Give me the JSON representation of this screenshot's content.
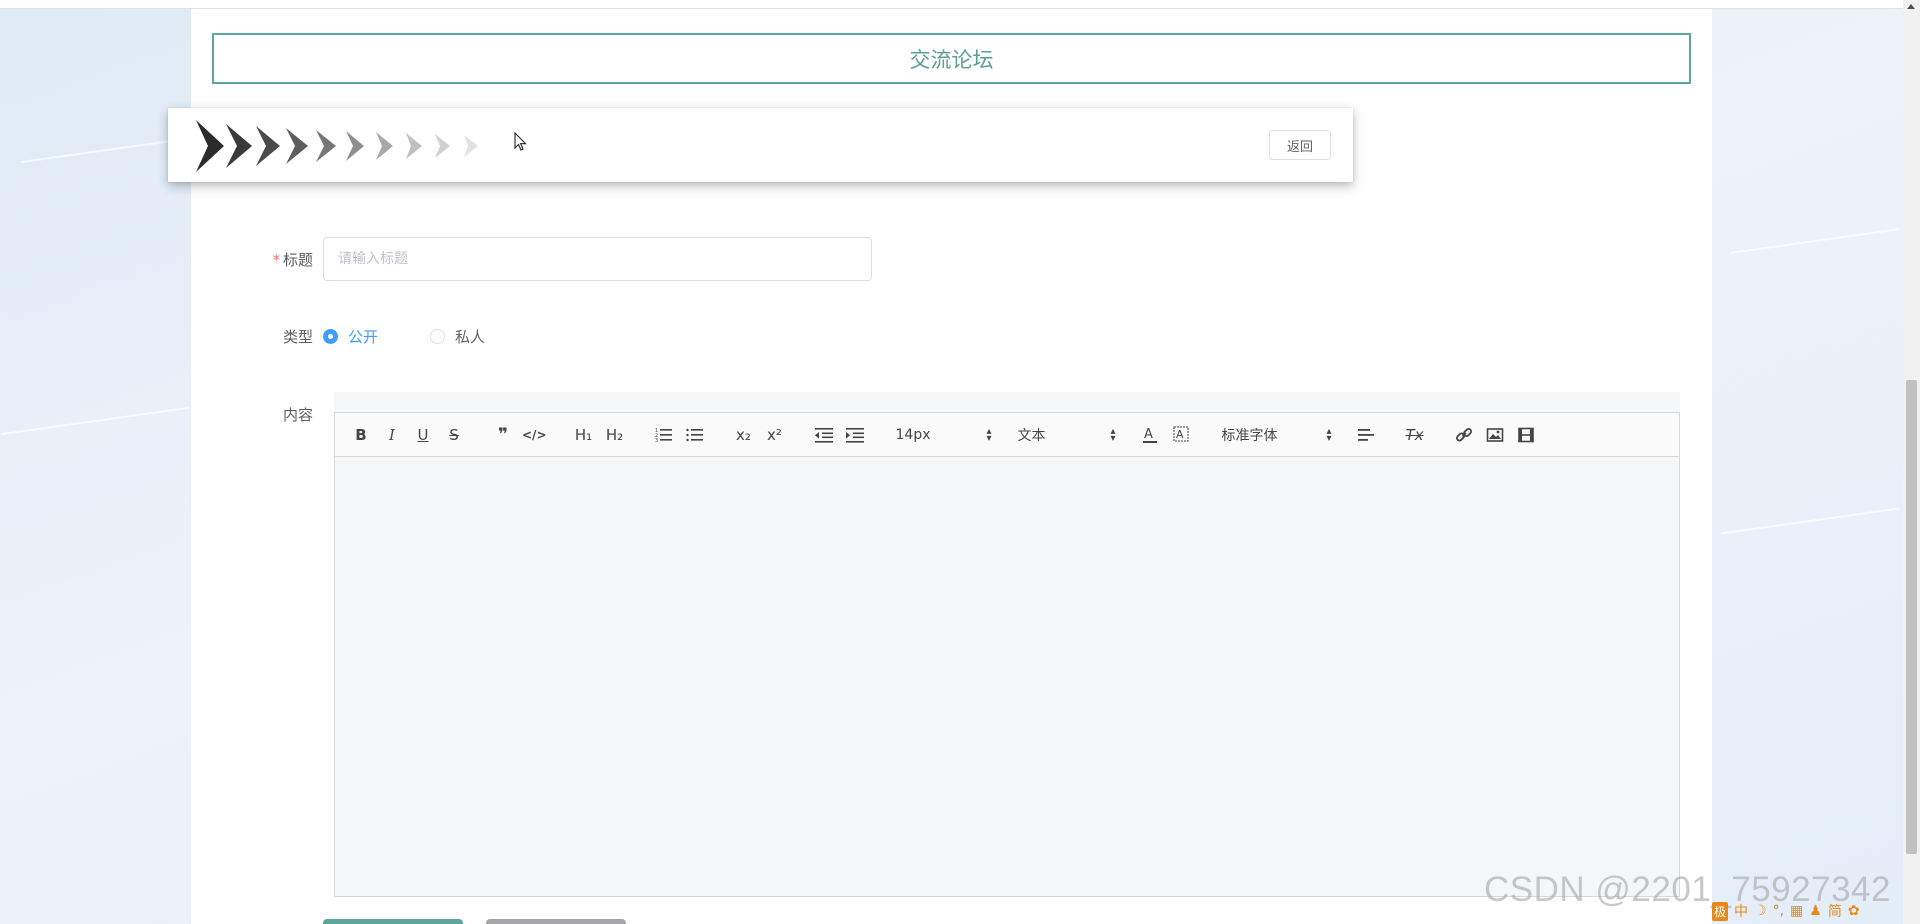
{
  "header": {
    "title": "交流论坛"
  },
  "banner": {
    "back_label": "返回"
  },
  "form": {
    "title_field": {
      "label": "标题",
      "required_mark": "*",
      "placeholder": "请输入标题",
      "value": ""
    },
    "type_field": {
      "label": "类型",
      "options": [
        {
          "label": "公开",
          "checked": true
        },
        {
          "label": "私人",
          "checked": false
        }
      ]
    },
    "content_field": {
      "label": "内容"
    }
  },
  "toolbar": {
    "bold": "B",
    "italic": "I",
    "underline": "U",
    "strike": "S",
    "blockquote": "❞",
    "code": "</>",
    "h1": "H₁",
    "h2": "H₂",
    "subscript": "x₂",
    "superscript": "x²",
    "font_size": "14px",
    "header_select": "文本",
    "font_family": "标准字体",
    "clean": "Tx"
  },
  "watermark": "CSDN @2201_75927342",
  "ime": {
    "items": [
      "极",
      "中",
      "☽",
      "°,",
      "▦",
      "♟",
      "简",
      "✿"
    ]
  },
  "colors": {
    "accent": "#5ea69c",
    "primary": "#409eff",
    "required": "#f56c6c"
  }
}
